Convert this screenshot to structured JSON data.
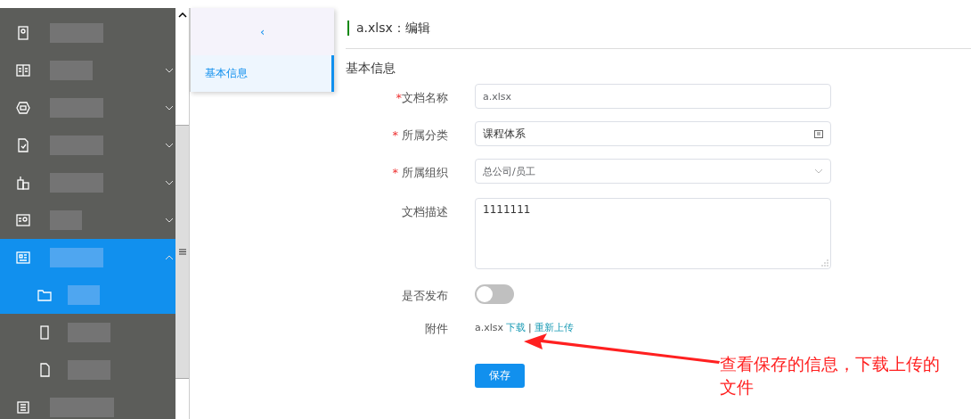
{
  "sidebar": {
    "items": [
      {
        "kind": "link",
        "selected": false
      },
      {
        "kind": "group",
        "expanded": false,
        "selected": false
      },
      {
        "kind": "group",
        "expanded": false,
        "selected": false
      },
      {
        "kind": "group",
        "expanded": false,
        "selected": false
      },
      {
        "kind": "group",
        "expanded": false,
        "selected": false
      },
      {
        "kind": "group",
        "expanded": false,
        "selected": false
      },
      {
        "kind": "group",
        "expanded": true,
        "selected": true,
        "children": [
          {
            "selected": true
          },
          {
            "selected": false
          },
          {
            "selected": false
          }
        ]
      },
      {
        "kind": "link",
        "selected": false
      }
    ]
  },
  "subnav": {
    "collapse": "‹",
    "tabs": [
      {
        "label": "基本信息",
        "selected": true
      }
    ]
  },
  "page": {
    "title": "a.xlsx：编辑",
    "section": "基本信息"
  },
  "form": {
    "fields": [
      {
        "kind": "text",
        "label": "文档名称",
        "required_mark": "*",
        "value": "a.xlsx"
      },
      {
        "kind": "picker",
        "label": "所属分类",
        "required_mark": "*",
        "value": "课程体系"
      },
      {
        "kind": "select",
        "label": "所属组织",
        "required_mark": "*",
        "value": "总公司/员工"
      },
      {
        "kind": "textarea",
        "label": "文档描述",
        "value": "1111111"
      },
      {
        "kind": "switch",
        "label": "是否发布",
        "on": false
      },
      {
        "kind": "file",
        "label": "附件",
        "file": "a.xlsx",
        "links": [
          "下载",
          "重新上传"
        ],
        "separator": "|"
      }
    ],
    "submit": "保存"
  },
  "annotation": {
    "text": "查看保存的信息，下载上传的文件"
  }
}
